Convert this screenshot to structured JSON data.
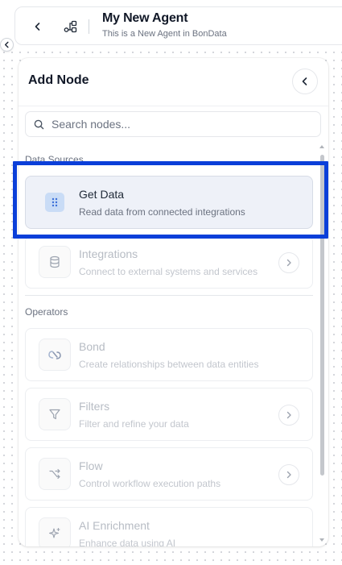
{
  "header": {
    "title": "My New Agent",
    "subtitle": "This is a New Agent in BonData"
  },
  "panel": {
    "title": "Add Node",
    "search": {
      "placeholder": "Search nodes...",
      "value": ""
    },
    "sections": [
      {
        "label": "Data Sources",
        "items": [
          {
            "title": "Get Data",
            "description": "Read data from connected integrations",
            "icon": "dots-grid-icon",
            "selected": true,
            "has_chevron": false
          },
          {
            "title": "Integrations",
            "description": "Connect to external systems and services",
            "icon": "database-icon",
            "selected": false,
            "has_chevron": true
          }
        ]
      },
      {
        "label": "Operators",
        "items": [
          {
            "title": "Bond",
            "description": "Create relationships between data entities",
            "icon": "link-icon",
            "selected": false,
            "has_chevron": false
          },
          {
            "title": "Filters",
            "description": "Filter and refine your data",
            "icon": "filter-icon",
            "selected": false,
            "has_chevron": true
          },
          {
            "title": "Flow",
            "description": "Control workflow execution paths",
            "icon": "shuffle-icon",
            "selected": false,
            "has_chevron": true
          },
          {
            "title": "AI Enrichment",
            "description": "Enhance data using AI",
            "icon": "sparkle-icon",
            "selected": false,
            "has_chevron": false
          }
        ]
      }
    ]
  },
  "colors": {
    "highlight": "#0b3fd9",
    "selected_bg": "#eef1f8",
    "selected_icon_bg": "#c9dcf6",
    "icon_blue": "#3b6fd8"
  }
}
